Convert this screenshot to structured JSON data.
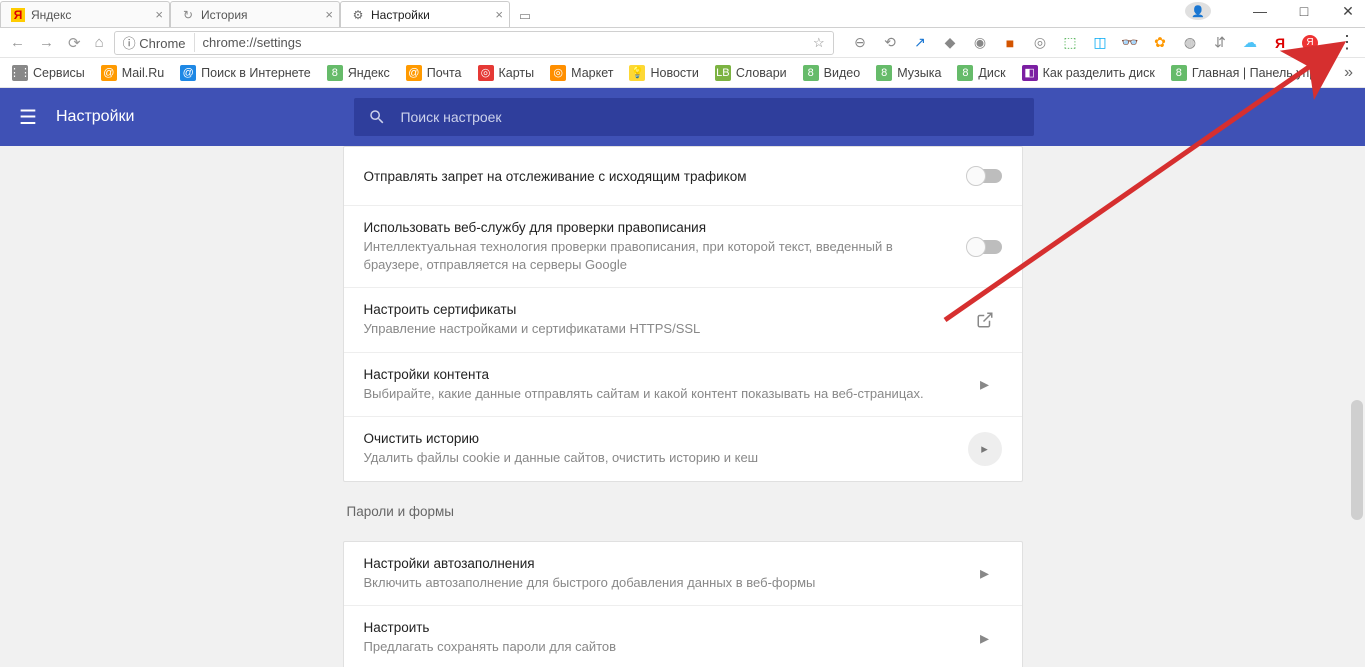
{
  "tabs": [
    {
      "label": "Яндекс",
      "icon": "Я",
      "icon_bg": "#ffcc00",
      "icon_color": "#d00"
    },
    {
      "label": "История",
      "icon": "↻",
      "icon_bg": "transparent",
      "icon_color": "#888"
    },
    {
      "label": "Настройки",
      "icon": "⚙",
      "icon_bg": "transparent",
      "icon_color": "#666",
      "active": true
    }
  ],
  "window_controls": {
    "profile": "👤",
    "min": "—",
    "max": "□",
    "close": "✕"
  },
  "toolbar": {
    "nav": {
      "back": "←",
      "fwd": "→",
      "reload": "⟳",
      "home": "⌂"
    },
    "security_label": "Chrome",
    "url": "chrome://settings",
    "star": "☆"
  },
  "ext_icons": [
    "⊖",
    "⟲",
    "↗",
    "◆",
    "◉",
    "■",
    "◎",
    "⬚",
    "◫",
    "👓",
    "✿",
    "◍",
    "⇵",
    "☁",
    "Я"
  ],
  "ext_red": "Я",
  "menu_dots": "⋮",
  "bookmarks": [
    {
      "label": "Сервисы",
      "icon": "⋮⋮",
      "bg": "#888"
    },
    {
      "label": "Mail.Ru",
      "icon": "@",
      "bg": "#ff9a00"
    },
    {
      "label": "Поиск в Интернете",
      "icon": "@",
      "bg": "#1e88e5"
    },
    {
      "label": "Яндекс",
      "icon": "8",
      "bg": "#66bb6a"
    },
    {
      "label": "Почта",
      "icon": "@",
      "bg": "#ff9a00"
    },
    {
      "label": "Карты",
      "icon": "◎",
      "bg": "#e53935"
    },
    {
      "label": "Маркет",
      "icon": "◎",
      "bg": "#ff8f00"
    },
    {
      "label": "Новости",
      "icon": "💡",
      "bg": "#fdd835"
    },
    {
      "label": "Словари",
      "icon": "LB",
      "bg": "#7cb342"
    },
    {
      "label": "Видео",
      "icon": "8",
      "bg": "#66bb6a"
    },
    {
      "label": "Музыка",
      "icon": "8",
      "bg": "#66bb6a"
    },
    {
      "label": "Диск",
      "icon": "8",
      "bg": "#66bb6a"
    },
    {
      "label": "Как разделить диск",
      "icon": "◧",
      "bg": "#7b1fa2"
    },
    {
      "label": "Главная | Панель упр",
      "icon": "8",
      "bg": "#66bb6a"
    }
  ],
  "bm_more": "»",
  "header": {
    "title": "Настройки",
    "search_placeholder": "Поиск настроек"
  },
  "sections": {
    "privacy": [
      {
        "title": "Отправлять запрет на отслеживание с исходящим трафиком",
        "sub": "",
        "action": "toggle"
      },
      {
        "title": "Использовать веб-службу для проверки правописания",
        "sub": "Интеллектуальная технология проверки правописания, при которой текст, введенный в браузере, отправляется на серверы Google",
        "action": "toggle"
      },
      {
        "title": "Настроить сертификаты",
        "sub": "Управление настройками и сертификатами HTTPS/SSL",
        "action": "external"
      },
      {
        "title": "Настройки контента",
        "sub": "Выбирайте, какие данные отправлять сайтам и какой контент показывать на веб-страницах.",
        "action": "arrow"
      },
      {
        "title": "Очистить историю",
        "sub": "Удалить файлы cookie и данные сайтов, очистить историю и кеш",
        "action": "circle"
      }
    ],
    "passwords_label": "Пароли и формы",
    "passwords": [
      {
        "title": "Настройки автозаполнения",
        "sub": "Включить автозаполнение для быстрого добавления данных в веб-формы",
        "action": "arrow"
      },
      {
        "title": "Настроить",
        "sub": "Предлагать сохранять пароли для сайтов",
        "action": "arrow"
      }
    ]
  }
}
